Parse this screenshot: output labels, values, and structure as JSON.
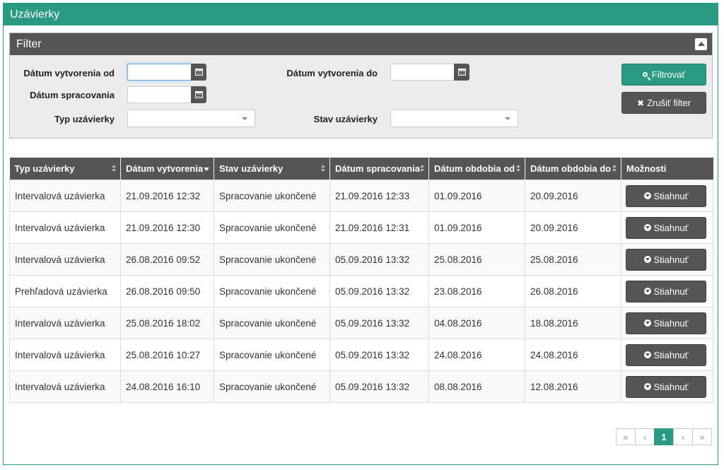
{
  "page": {
    "title": "Uzávierky"
  },
  "filter": {
    "title": "Filter",
    "date_created_from_label": "Dátum vytvorenia od",
    "date_created_to_label": "Dátum vytvorenia do",
    "processing_date_label": "Dátum spracovania",
    "closing_type_label": "Typ uzávierky",
    "closing_state_label": "Stav uzávierky",
    "date_created_from_value": "",
    "date_created_to_value": "",
    "processing_date_value": "",
    "closing_type_value": "",
    "closing_state_value": "",
    "filter_button": "Filtrovať",
    "clear_button": "Zrušiť filter"
  },
  "table": {
    "columns": [
      "Typ uzávierky",
      "Dátum vytvorenia",
      "Stav uzávierky",
      "Dátum spracovania",
      "Dátum obdobia od",
      "Dátum obdobia do",
      "Možnosti"
    ],
    "download_label": "Stiahnuť",
    "rows": [
      [
        "Intervalová uzávierka",
        "21.09.2016 12:32",
        "Spracovanie ukončené",
        "21.09.2016 12:33",
        "01.09.2016",
        "20.09.2016"
      ],
      [
        "Intervalová uzávierka",
        "21.09.2016 12:30",
        "Spracovanie ukončené",
        "21.09.2016 12:31",
        "01.09.2016",
        "20.09.2016"
      ],
      [
        "Intervalová uzávierka",
        "26.08.2016 09:52",
        "Spracovanie ukončené",
        "05.09.2016 13:32",
        "25.08.2016",
        "25.08.2016"
      ],
      [
        "Prehľadová uzávierka",
        "26.08.2016 09:50",
        "Spracovanie ukončené",
        "05.09.2016 13:32",
        "23.08.2016",
        "26.08.2016"
      ],
      [
        "Intervalová uzávierka",
        "25.08.2016 18:02",
        "Spracovanie ukončené",
        "05.09.2016 13:32",
        "04.08.2016",
        "18.08.2016"
      ],
      [
        "Intervalová uzávierka",
        "25.08.2016 10:27",
        "Spracovanie ukončené",
        "05.09.2016 13:32",
        "24.08.2016",
        "24.08.2016"
      ],
      [
        "Intervalová uzávierka",
        "24.08.2016 16:10",
        "Spracovanie ukončené",
        "05.09.2016 13:32",
        "08.08.2016",
        "12.08.2016"
      ]
    ]
  },
  "pagination": {
    "first": "«",
    "prev": "‹",
    "current": "1",
    "next": "›",
    "last": "»"
  },
  "colors": {
    "accent": "#2b9a83",
    "header_dark": "#555555",
    "filter_bg": "#ececec"
  },
  "icons": {
    "collapse": "collapse-icon",
    "calendar": "calendar-icon",
    "search": "search-icon",
    "clear": "close-icon",
    "download": "download-icon",
    "sort": "sort-icon",
    "sort_desc": "sort-desc-icon"
  }
}
